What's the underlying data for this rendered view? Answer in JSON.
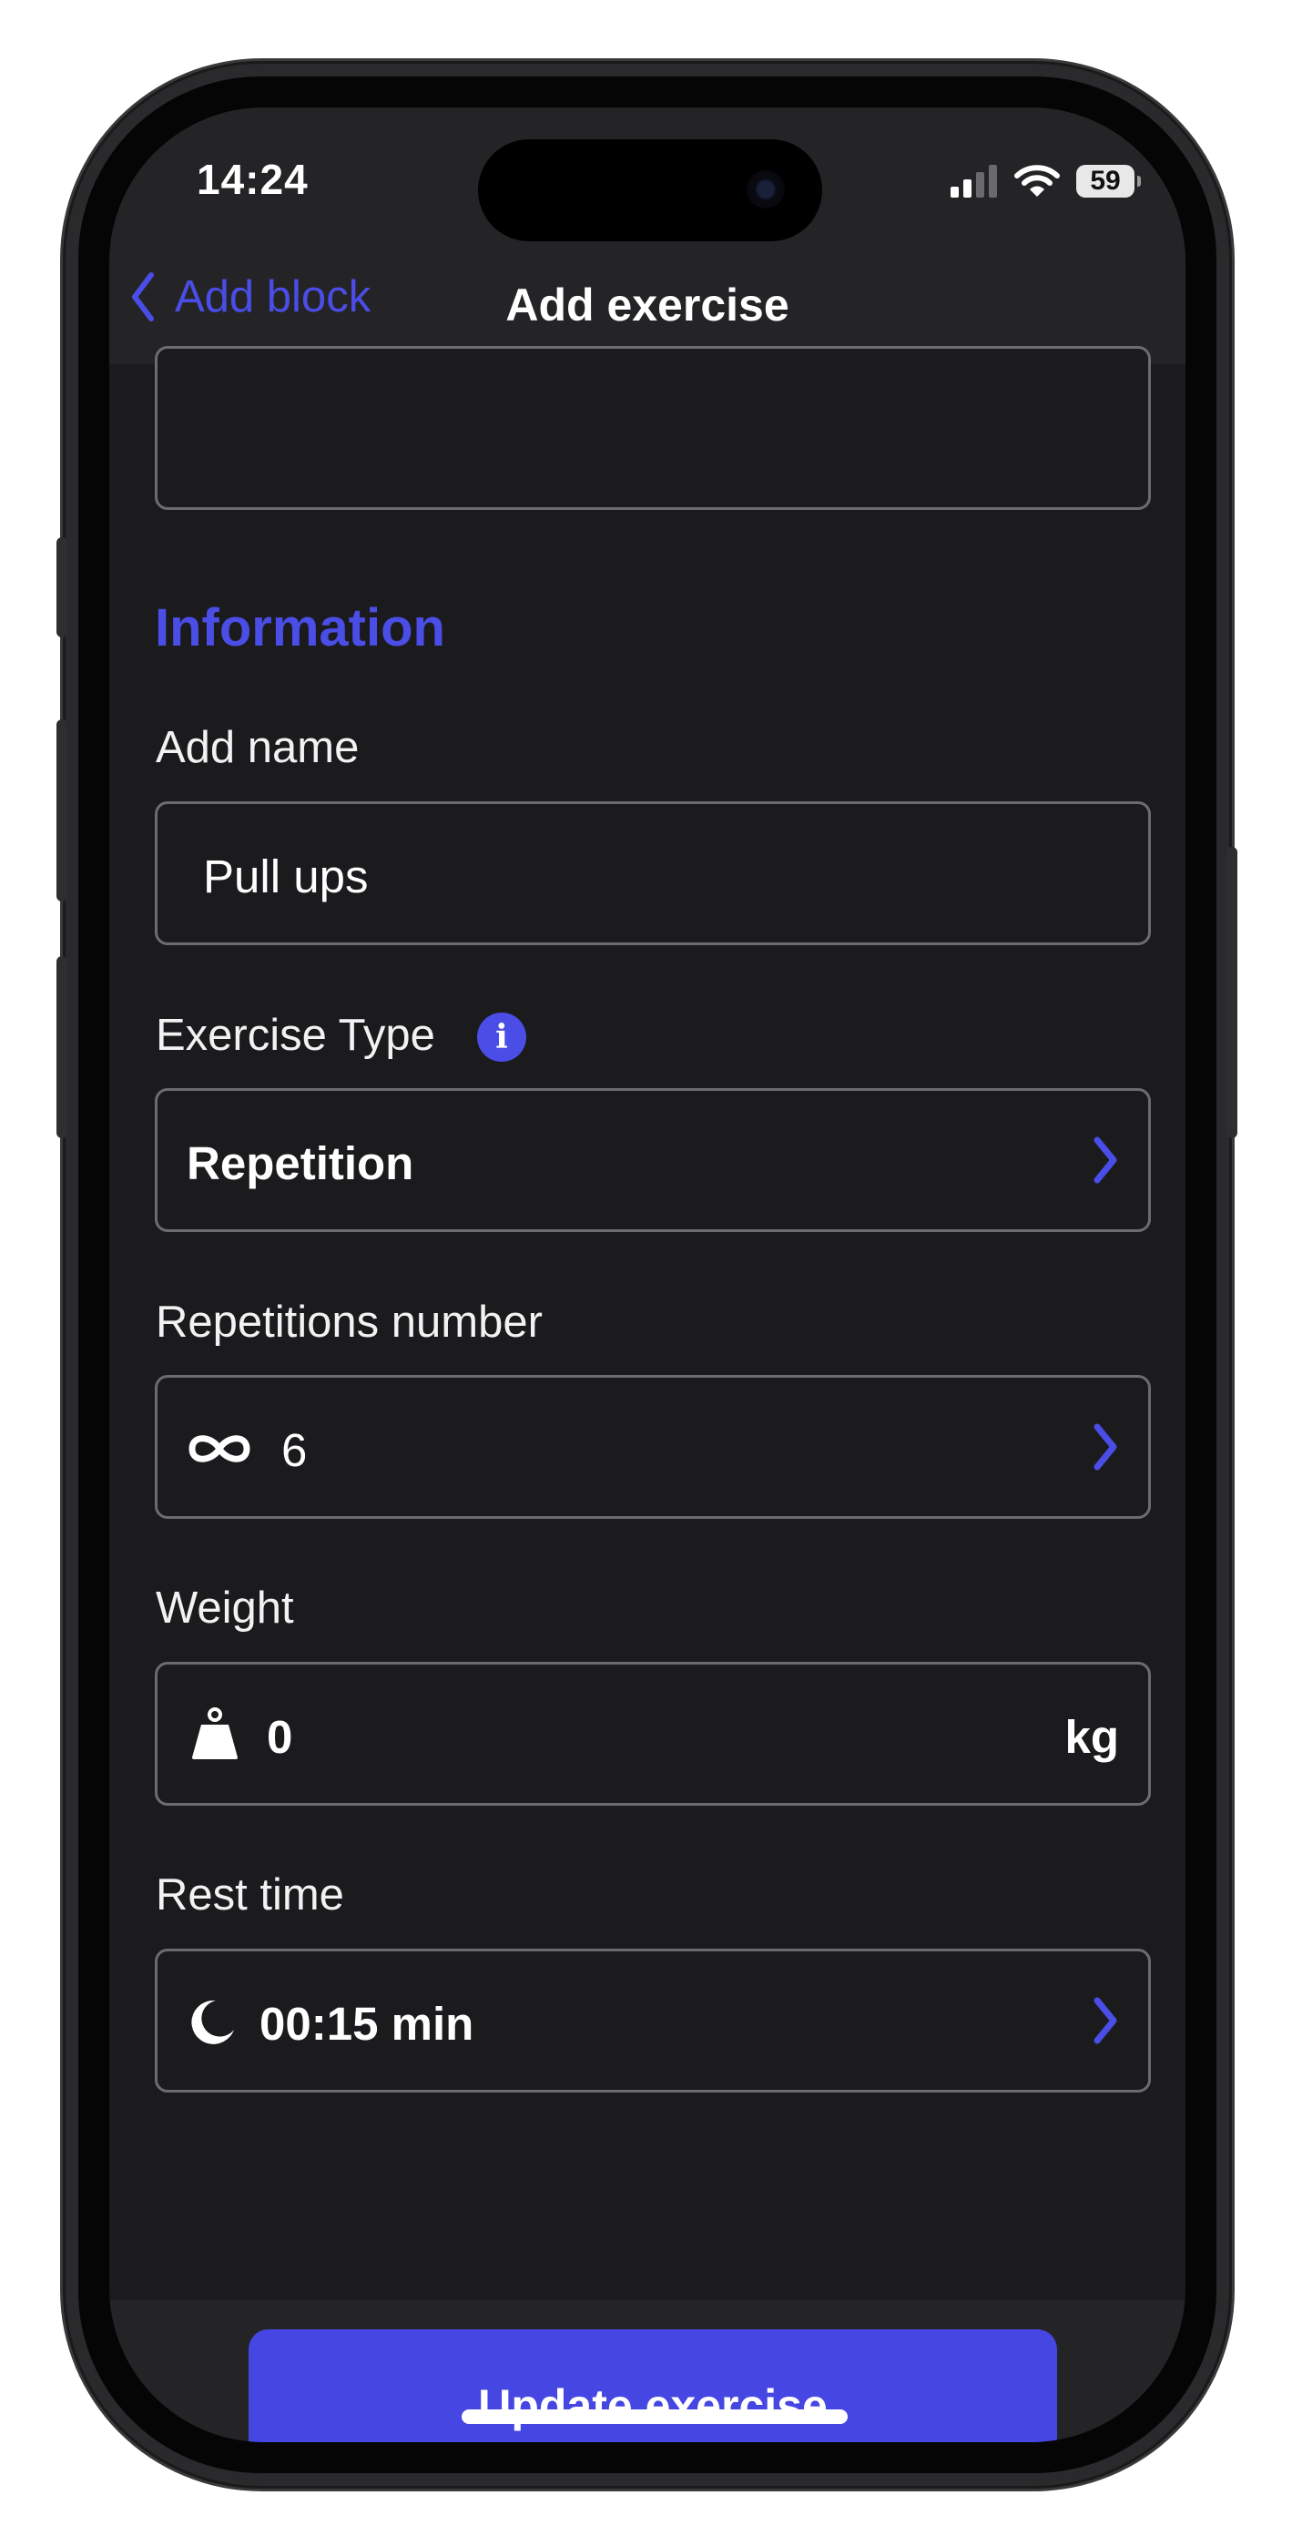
{
  "status_bar": {
    "time": "14:24",
    "battery": "59"
  },
  "nav": {
    "back_label": "Add block",
    "title": "Add exercise"
  },
  "info_section": {
    "title": "Information",
    "name_label": "Add name",
    "name_value": "Pull ups",
    "type_label": "Exercise Type",
    "type_info_glyph": "i",
    "type_value": "Repetition",
    "reps_label": "Repetitions number",
    "reps_value": "6",
    "weight_label": "Weight",
    "weight_value": "0",
    "weight_unit": "kg",
    "rest_label": "Rest time",
    "rest_value": "00:15 min"
  },
  "footer": {
    "button_label": "Update exercise"
  },
  "colors": {
    "accent": "#4646e3",
    "background": "#1b1b1e",
    "bar": "#242427",
    "border": "#6c6c70"
  },
  "icons": [
    "chevron-left-icon",
    "info-icon",
    "chevron-right-icon",
    "infinity-icon",
    "kettlebell-icon",
    "moon-icon",
    "signal-icon",
    "wifi-icon",
    "battery-icon"
  ]
}
